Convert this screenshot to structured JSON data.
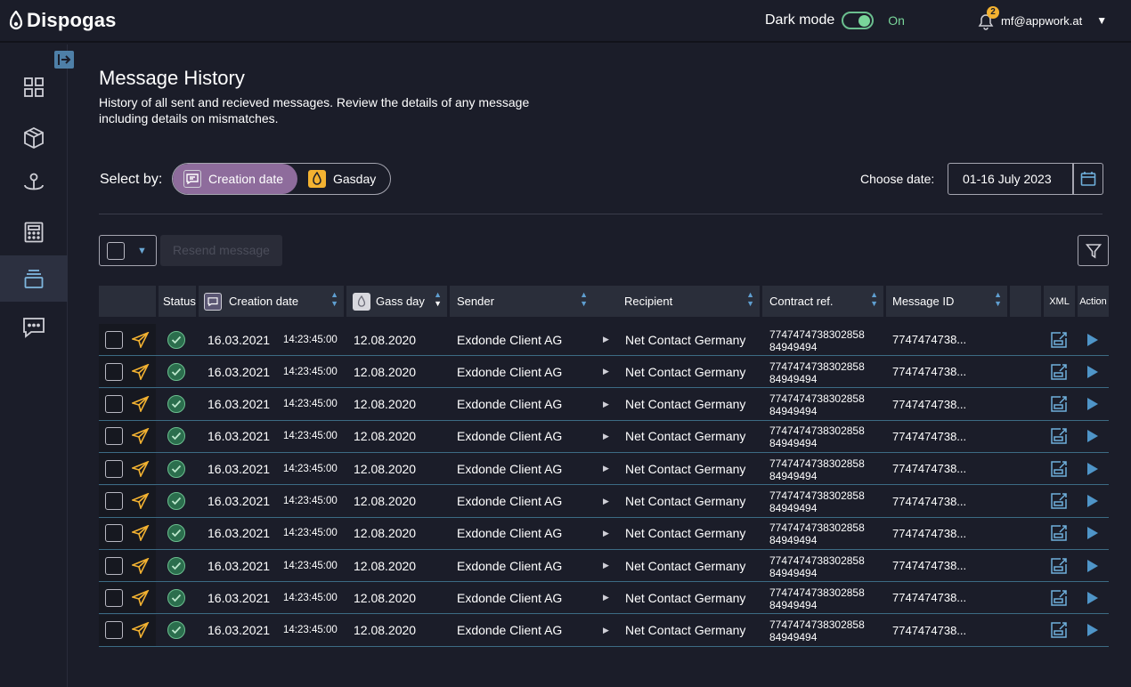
{
  "app": {
    "name": "Dispogas"
  },
  "header": {
    "dark_mode_label": "Dark mode",
    "dark_mode_state": "On",
    "notification_count": "2",
    "user_email": "mf@appwork.at"
  },
  "sidebar": {
    "items": [
      {
        "name": "dashboard",
        "icon": "grid-icon",
        "active": false
      },
      {
        "name": "products",
        "icon": "cube-icon",
        "active": false
      },
      {
        "name": "locations",
        "icon": "anchor-pin-icon",
        "active": false
      },
      {
        "name": "calculator",
        "icon": "calculator-icon",
        "active": false
      },
      {
        "name": "message-history",
        "icon": "stack-icon",
        "active": true
      },
      {
        "name": "chat",
        "icon": "chat-icon",
        "active": false
      }
    ]
  },
  "page": {
    "title": "Message History",
    "subtitle": "History of all sent and recieved messages.  Review the details of any message including details on mismatches."
  },
  "filters": {
    "select_by_label": "Select by:",
    "options": [
      "Creation date",
      "Gasday"
    ],
    "selected": "Creation date",
    "choose_date_label": "Choose date:",
    "date_value": "01-16 July 2023"
  },
  "toolbar": {
    "resend_label": "Resend message"
  },
  "table": {
    "columns": {
      "status": "Status",
      "creation_date": "Creation date",
      "gas_day": "Gass day",
      "sender": "Sender",
      "recipient": "Recipient",
      "contract_ref": "Contract ref.",
      "message_id": "Message ID",
      "xml": "XML",
      "action": "Action"
    },
    "rows": [
      {
        "date": "16.03.2021",
        "time": "14:23:45:00",
        "gas_day": "12.08.2020",
        "sender": "Exdonde Client AG",
        "recipient": "Net Contact Germany",
        "contract_ref_1": "7747474738302858",
        "contract_ref_2": "84949494",
        "message_id": "7747474738..."
      },
      {
        "date": "16.03.2021",
        "time": "14:23:45:00",
        "gas_day": "12.08.2020",
        "sender": "Exdonde Client AG",
        "recipient": "Net Contact Germany",
        "contract_ref_1": "7747474738302858",
        "contract_ref_2": "84949494",
        "message_id": "7747474738..."
      },
      {
        "date": "16.03.2021",
        "time": "14:23:45:00",
        "gas_day": "12.08.2020",
        "sender": "Exdonde Client AG",
        "recipient": "Net Contact Germany",
        "contract_ref_1": "7747474738302858",
        "contract_ref_2": "84949494",
        "message_id": "7747474738..."
      },
      {
        "date": "16.03.2021",
        "time": "14:23:45:00",
        "gas_day": "12.08.2020",
        "sender": "Exdonde Client AG",
        "recipient": "Net Contact Germany",
        "contract_ref_1": "7747474738302858",
        "contract_ref_2": "84949494",
        "message_id": "7747474738..."
      },
      {
        "date": "16.03.2021",
        "time": "14:23:45:00",
        "gas_day": "12.08.2020",
        "sender": "Exdonde Client AG",
        "recipient": "Net Contact Germany",
        "contract_ref_1": "7747474738302858",
        "contract_ref_2": "84949494",
        "message_id": "7747474738..."
      },
      {
        "date": "16.03.2021",
        "time": "14:23:45:00",
        "gas_day": "12.08.2020",
        "sender": "Exdonde Client AG",
        "recipient": "Net Contact Germany",
        "contract_ref_1": "7747474738302858",
        "contract_ref_2": "84949494",
        "message_id": "7747474738..."
      },
      {
        "date": "16.03.2021",
        "time": "14:23:45:00",
        "gas_day": "12.08.2020",
        "sender": "Exdonde Client AG",
        "recipient": "Net Contact Germany",
        "contract_ref_1": "7747474738302858",
        "contract_ref_2": "84949494",
        "message_id": "7747474738..."
      },
      {
        "date": "16.03.2021",
        "time": "14:23:45:00",
        "gas_day": "12.08.2020",
        "sender": "Exdonde Client AG",
        "recipient": "Net Contact Germany",
        "contract_ref_1": "7747474738302858",
        "contract_ref_2": "84949494",
        "message_id": "7747474738..."
      },
      {
        "date": "16.03.2021",
        "time": "14:23:45:00",
        "gas_day": "12.08.2020",
        "sender": "Exdonde Client AG",
        "recipient": "Net Contact Germany",
        "contract_ref_1": "7747474738302858",
        "contract_ref_2": "84949494",
        "message_id": "7747474738..."
      },
      {
        "date": "16.03.2021",
        "time": "14:23:45:00",
        "gas_day": "12.08.2020",
        "sender": "Exdonde Client AG",
        "recipient": "Net Contact Germany",
        "contract_ref_1": "7747474738302858",
        "contract_ref_2": "84949494",
        "message_id": "7747474738..."
      }
    ]
  },
  "colors": {
    "background": "#1b1d29",
    "accent_purple": "#8e6c9c",
    "accent_blue": "#5f9fd1",
    "status_green": "#6bbf8f",
    "warning_yellow": "#f3b231"
  }
}
